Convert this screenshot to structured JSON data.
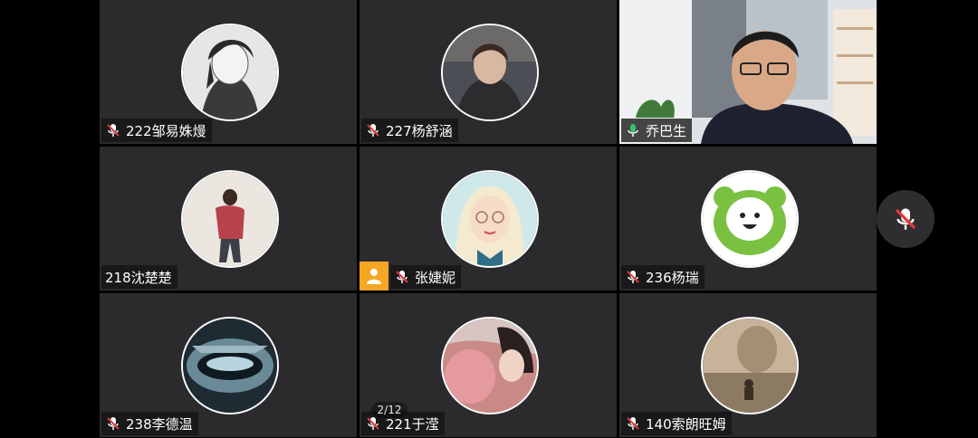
{
  "participants": [
    {
      "name": "222邹易姝熳",
      "mic": "muted"
    },
    {
      "name": "227杨舒涵",
      "mic": "muted"
    },
    {
      "name": "乔巴生",
      "mic": "active"
    },
    {
      "name": "218沈楚楚",
      "mic": "none"
    },
    {
      "name": "张婕妮",
      "mic": "muted",
      "host": true
    },
    {
      "name": "236杨瑞",
      "mic": "muted"
    },
    {
      "name": "238李德温",
      "mic": "muted"
    },
    {
      "name": "221于滢",
      "mic": "muted"
    },
    {
      "name": "140索朗旺姆",
      "mic": "muted"
    }
  ],
  "pager": {
    "text": "2/12"
  },
  "colors": {
    "tile_bg": "#2b2b2d",
    "active_border": "#38c172",
    "muted_red": "#e0393e",
    "active_green": "#38c172",
    "host_badge": "#f5a623"
  },
  "icons": {
    "mic_muted": "mic-muted-icon",
    "mic_active": "mic-active-icon",
    "host": "person-icon",
    "float": "mic-muted-icon"
  }
}
